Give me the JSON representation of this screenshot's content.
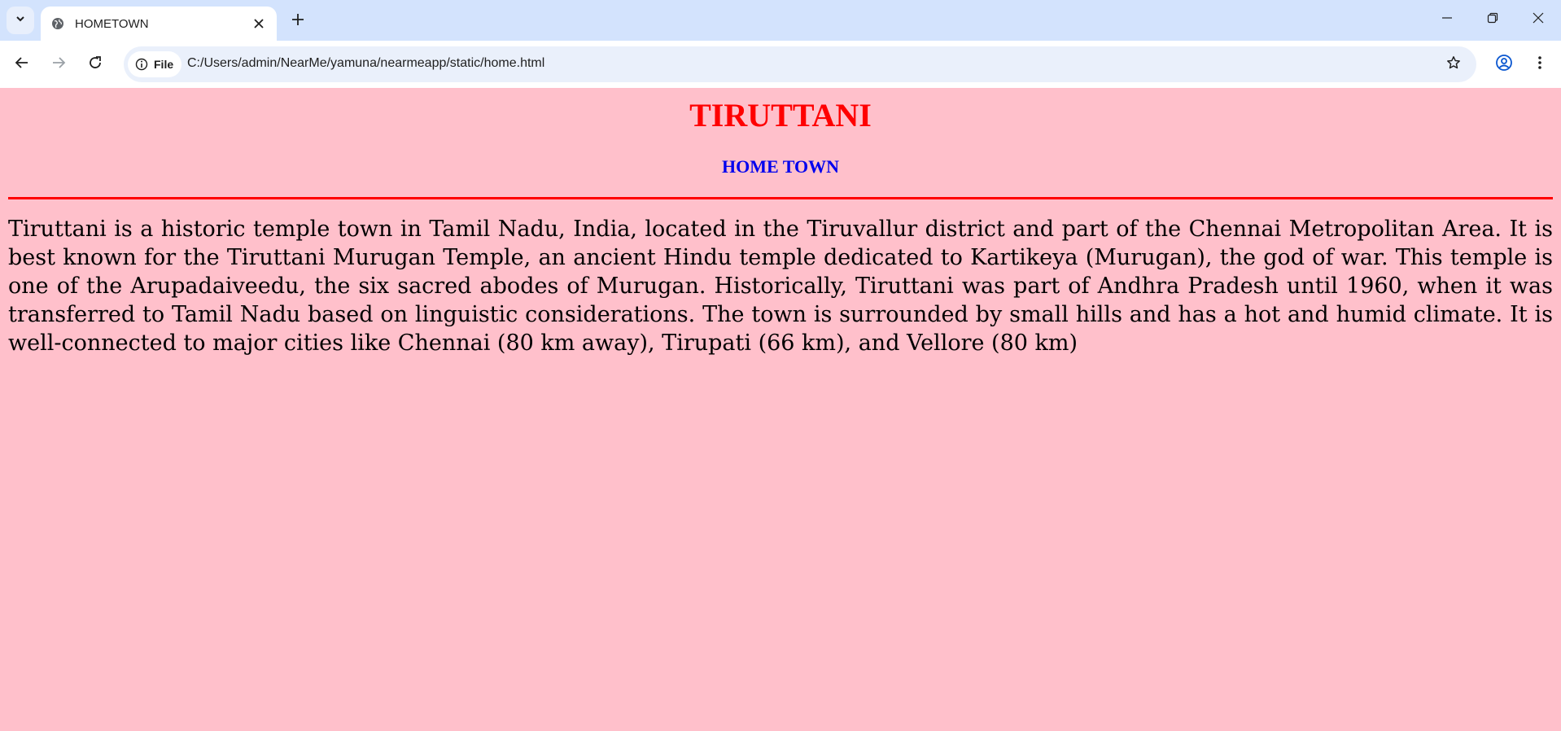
{
  "browser": {
    "tab_title": "HOMETOWN",
    "site_chip_label": "File",
    "url": "C:/Users/admin/NearMe/yamuna/nearmeapp/static/home.html",
    "icons": {
      "tab_search": "chevron-down-icon",
      "favicon": "globe-icon",
      "tab_close": "close-icon",
      "new_tab": "plus-icon",
      "minimize": "minimize-icon",
      "maximize": "restore-icon",
      "close": "close-icon",
      "back": "arrow-left-icon",
      "forward": "arrow-right-icon",
      "reload": "reload-icon",
      "site_info": "info-icon",
      "bookmark": "star-icon",
      "profile": "profile-icon",
      "menu": "kebab-menu-icon"
    }
  },
  "page": {
    "title": "TIRUTTANI",
    "subtitle": "HOME TOWN",
    "body": "Tiruttani is a historic temple town in Tamil Nadu, India, located in the Tiruvallur district and part of the Chennai Metropolitan Area. It is best known for the Tiruttani Murugan Temple, an ancient Hindu temple dedicated to Kartikeya (Murugan), the god of war. This temple is one of the Arupadaiveedu, the six sacred abodes of Murugan. Historically, Tiruttani was part of Andhra Pradesh until 1960, when it was transferred to Tamil Nadu based on linguistic considerations. The town is surrounded by small hills and has a hot and humid climate. It is well-connected to major cities like Chennai (80 km away), Tirupati (66 km), and Vellore (80 km)",
    "colors": {
      "background": "#ffc0cb",
      "title": "#ff0000",
      "subtitle": "#0000ee",
      "divider": "#ff0000"
    }
  }
}
